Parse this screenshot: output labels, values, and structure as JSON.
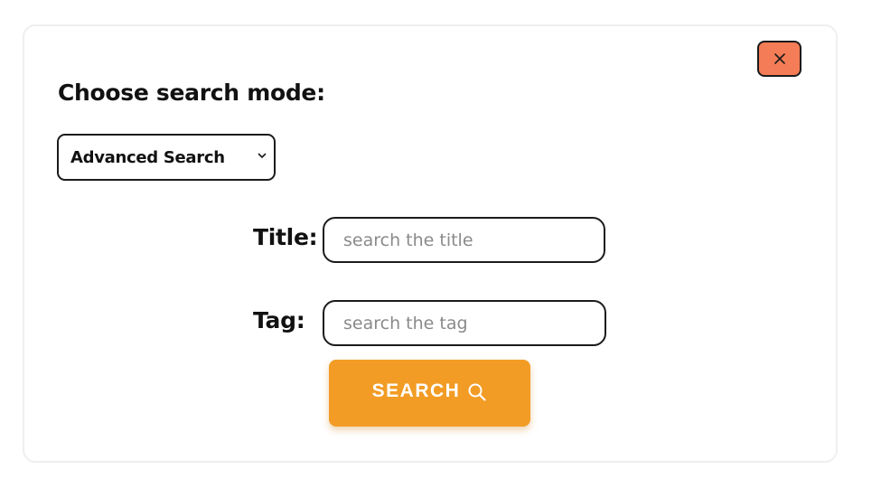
{
  "dialog": {
    "close_icon": "close-icon",
    "heading": "Choose search mode:",
    "mode_select": {
      "selected": "Advanced Search",
      "icon": "chevron-down-icon"
    },
    "fields": [
      {
        "label": "Title:",
        "placeholder": "search the title",
        "value": ""
      },
      {
        "label": "Tag:",
        "placeholder": "search the tag",
        "value": ""
      }
    ],
    "search_button": {
      "label": "SEARCH",
      "icon": "search-icon"
    }
  },
  "colors": {
    "close_button_bg": "#f47c56",
    "search_button_bg": "#f29c25",
    "border": "#1b1b1b",
    "panel_border": "#efefef"
  }
}
